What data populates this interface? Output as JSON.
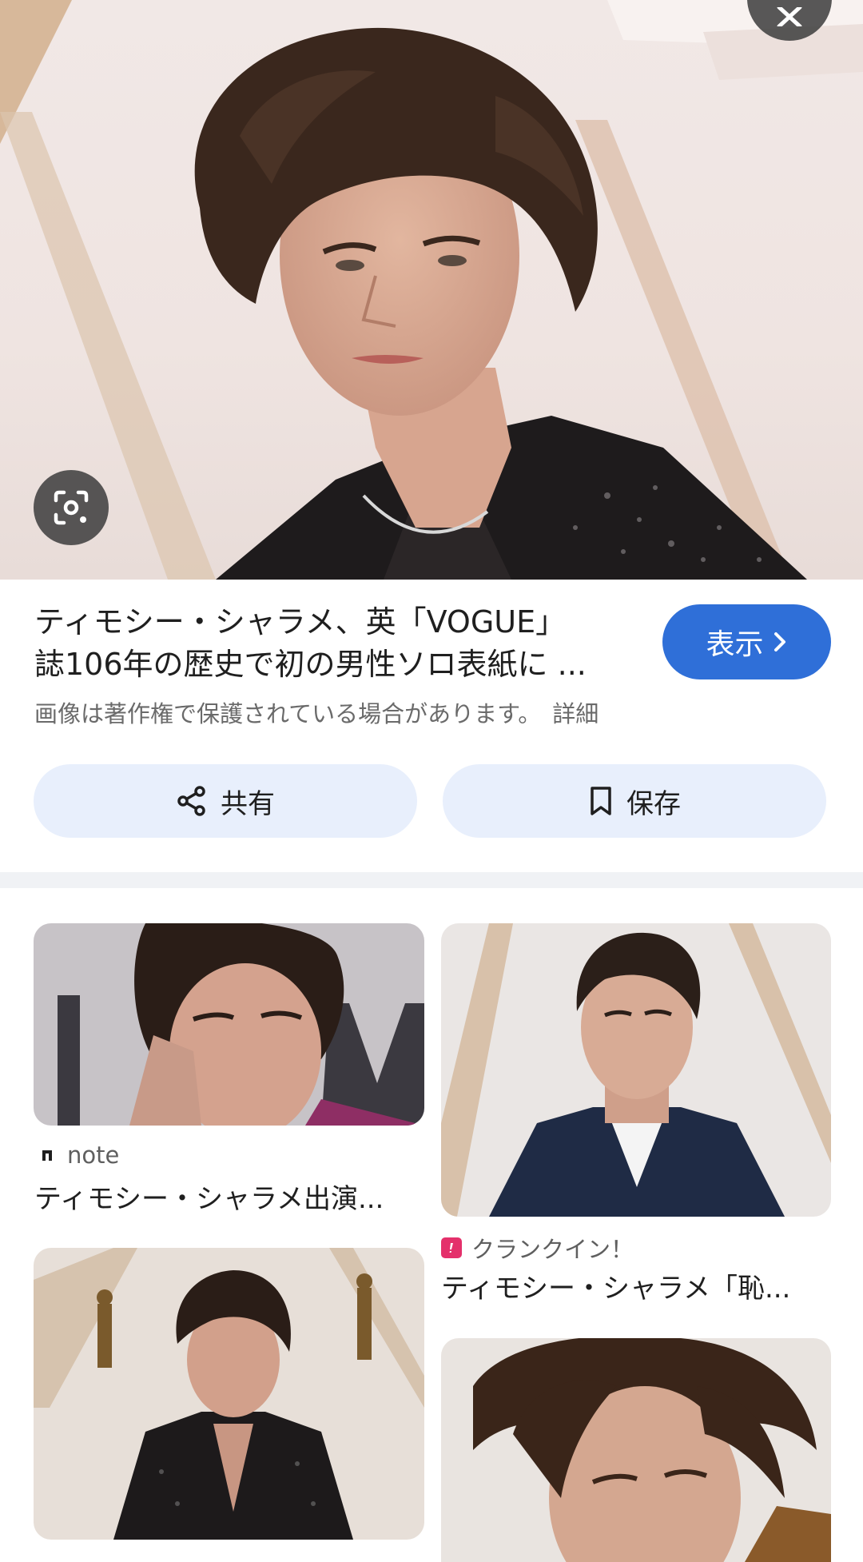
{
  "result": {
    "title_line1": "ティモシー・シャラメ、英「VOGUE」",
    "title_line2": "誌106年の歴史で初の男性ソロ表紙に ...",
    "visit_label": "表示",
    "copyright_notice": "画像は著作権で保護されている場合があります。",
    "details_link": "詳細"
  },
  "actions": {
    "share_label": "共有",
    "save_label": "保存"
  },
  "related": [
    {
      "source": "note",
      "title": "ティモシー・シャラメ出演..."
    },
    {
      "source": "クランクイン！",
      "title": "ティモシー・シャラメ「恥..."
    }
  ],
  "colors": {
    "accent": "#2f6fd8",
    "chip_bg": "#e8effc",
    "divider": "#f0f2f5"
  },
  "icons": [
    "close-icon",
    "lens-icon",
    "chevron-right-icon",
    "share-icon",
    "bookmark-icon",
    "note-logo-icon",
    "crankin-logo-icon"
  ]
}
